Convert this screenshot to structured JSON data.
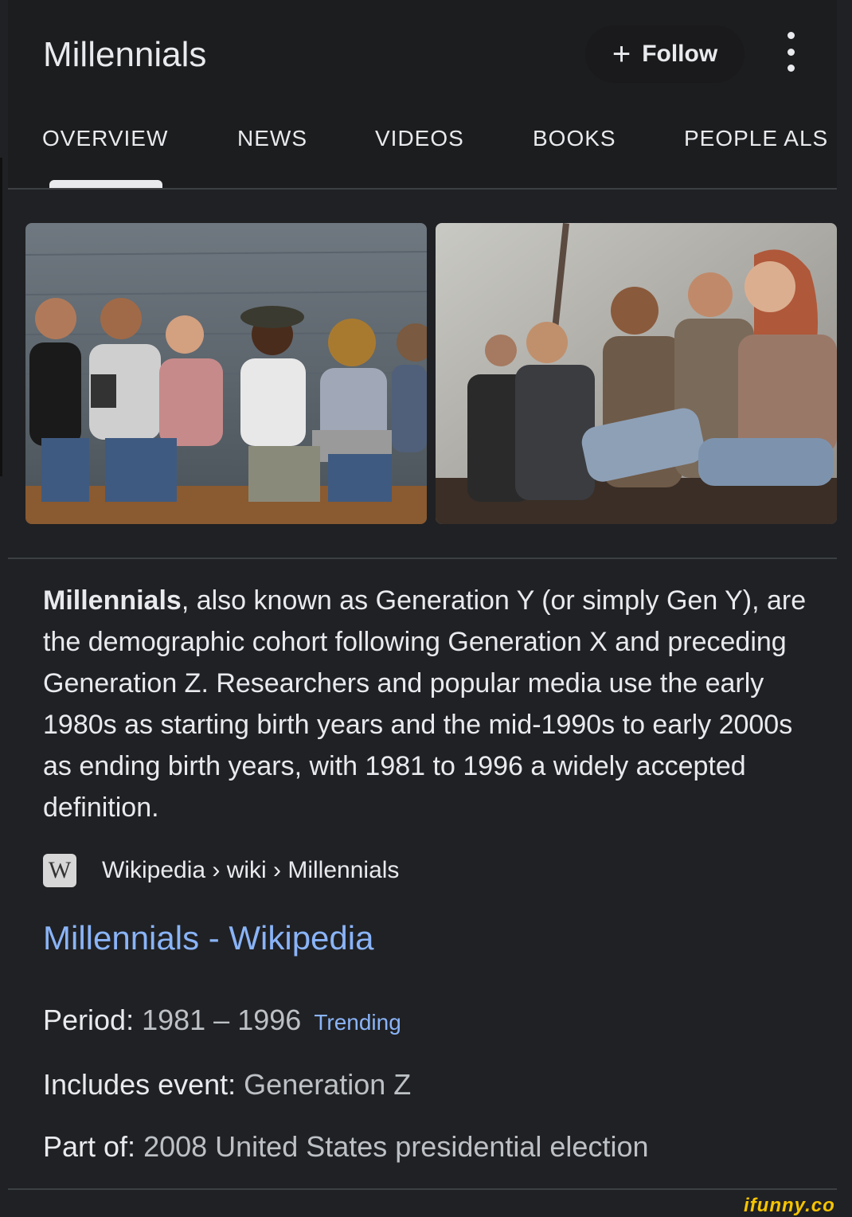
{
  "header": {
    "title": "Millennials",
    "follow_label": "Follow",
    "follow_icon": "plus-icon",
    "more_icon": "more-vert-icon"
  },
  "tabs": [
    {
      "label": "OVERVIEW",
      "selected": true
    },
    {
      "label": "NEWS"
    },
    {
      "label": "VIDEOS"
    },
    {
      "label": "BOOKS"
    },
    {
      "label": "PEOPLE ALS"
    }
  ],
  "description": {
    "bold_term": "Millennials",
    "text": ", also known as Generation Y (or simply Gen Y), are the demographic cohort following Generation X and preceding Generation Z. Researchers and popular media use the early 1980s as starting birth years and the mid-1990s to early 2000s as ending birth years, with 1981 to 1996 a widely accepted definition."
  },
  "source": {
    "icon": "wikipedia-icon",
    "icon_letter": "W",
    "breadcrumb": "Wikipedia › wiki › Millennials"
  },
  "link": {
    "title": "Millennials - Wikipedia"
  },
  "facts": {
    "period_label": "Period:",
    "period_value": "1981 – 1996",
    "trending": "Trending",
    "event_label": "Includes event:",
    "event_value": "Generation Z",
    "partof_label": "Part of:",
    "partof_value": "2008 United States presidential election"
  },
  "watermark": "ifunny.co",
  "colors": {
    "background": "#202124",
    "text": "#e8eaed",
    "link": "#8ab4f8",
    "muted": "#bdc1c6"
  }
}
